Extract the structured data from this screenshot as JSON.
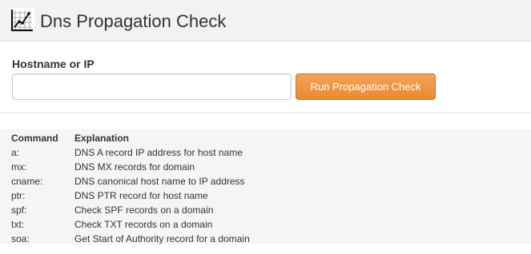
{
  "header": {
    "logo_icon": "line-chart-icon",
    "title": "Dns Propagation Check"
  },
  "form": {
    "label": "Hostname or IP",
    "input_value": "",
    "input_placeholder": "",
    "button_label": "Run Propagation Check",
    "button_color": "#e88a31"
  },
  "commands": {
    "headers": [
      "Command",
      "Explanation"
    ],
    "rows": [
      {
        "command": "a:",
        "explanation": "DNS A record IP address for host name"
      },
      {
        "command": "mx:",
        "explanation": "DNS MX records for domain"
      },
      {
        "command": "cname:",
        "explanation": "DNS canonical host name to IP address"
      },
      {
        "command": "ptr:",
        "explanation": "DNS PTR record for host name"
      },
      {
        "command": "spf:",
        "explanation": "Check SPF records on a domain"
      },
      {
        "command": "txt:",
        "explanation": "Check TXT records on a domain"
      },
      {
        "command": "soa:",
        "explanation": "Get Start of Authority record for a domain"
      }
    ]
  }
}
